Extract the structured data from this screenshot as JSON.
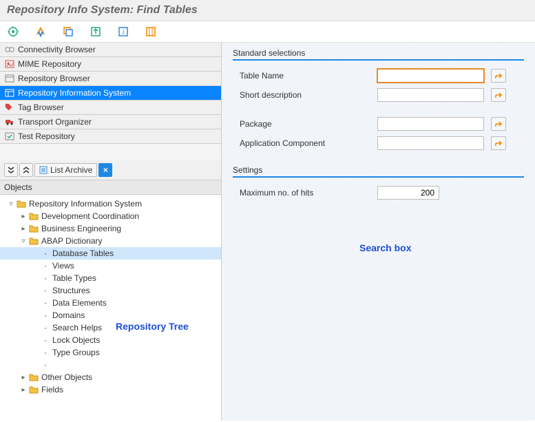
{
  "title": "Repository Info System: Find Tables",
  "nav": [
    {
      "label": "Connectivity Browser",
      "icon": "link"
    },
    {
      "label": "MIME Repository",
      "icon": "mime"
    },
    {
      "label": "Repository Browser",
      "icon": "repo"
    },
    {
      "label": "Repository Information System",
      "icon": "info",
      "selected": true
    },
    {
      "label": "Tag Browser",
      "icon": "tag"
    },
    {
      "label": "Transport Organizer",
      "icon": "truck"
    },
    {
      "label": "Test Repository",
      "icon": "test"
    }
  ],
  "mini_toolbar": {
    "list_label": "List Archive"
  },
  "objects_header": "Objects",
  "tree": [
    {
      "depth": 0,
      "toggle": "open",
      "icon": "folder",
      "label": "Repository Information System"
    },
    {
      "depth": 1,
      "toggle": "closed",
      "icon": "folder",
      "label": "Development Coordination"
    },
    {
      "depth": 1,
      "toggle": "closed",
      "icon": "folder",
      "label": "Business Engineering"
    },
    {
      "depth": 1,
      "toggle": "open",
      "icon": "folder",
      "label": "ABAP Dictionary"
    },
    {
      "depth": 2,
      "toggle": "leaf",
      "icon": "dot",
      "label": "Database Tables",
      "selected": true
    },
    {
      "depth": 2,
      "toggle": "leaf",
      "icon": "dot",
      "label": "Views"
    },
    {
      "depth": 2,
      "toggle": "leaf",
      "icon": "dot",
      "label": "Table Types"
    },
    {
      "depth": 2,
      "toggle": "leaf",
      "icon": "dot",
      "label": "Structures"
    },
    {
      "depth": 2,
      "toggle": "leaf",
      "icon": "dot",
      "label": "Data Elements"
    },
    {
      "depth": 2,
      "toggle": "leaf",
      "icon": "dot",
      "label": "Domains"
    },
    {
      "depth": 2,
      "toggle": "leaf",
      "icon": "dot",
      "label": "Search Helps"
    },
    {
      "depth": 2,
      "toggle": "leaf",
      "icon": "dot",
      "label": "Lock Objects"
    },
    {
      "depth": 2,
      "toggle": "leaf",
      "icon": "dot",
      "label": "Type Groups"
    },
    {
      "depth": 2,
      "toggle": "leaf",
      "icon": "dot",
      "label": ""
    },
    {
      "depth": 1,
      "toggle": "closed",
      "icon": "folder",
      "label": "Other Objects"
    },
    {
      "depth": 1,
      "toggle": "closed",
      "icon": "folder",
      "label": "Fields"
    }
  ],
  "standard_selections": {
    "title": "Standard selections",
    "fields": [
      {
        "label": "Table Name",
        "focus": true
      },
      {
        "label": "Short description"
      },
      {
        "label": "Package",
        "gap": true
      },
      {
        "label": "Application Component"
      }
    ]
  },
  "settings": {
    "title": "Settings",
    "hits_label": "Maximum no. of hits",
    "hits_value": "200"
  },
  "annotations": {
    "tree": "Repository Tree",
    "search": "Search box"
  }
}
